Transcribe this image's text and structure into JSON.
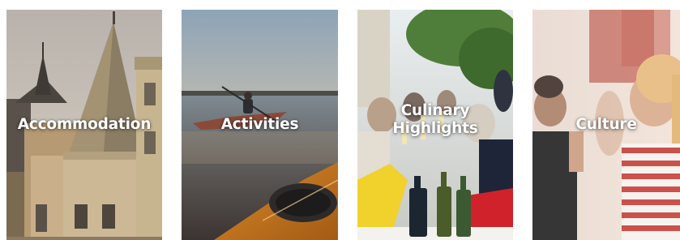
{
  "cards": [
    {
      "label": "Accommodation"
    },
    {
      "label": "Activities"
    },
    {
      "label": "Culinary Highlights"
    },
    {
      "label": "Culture"
    }
  ],
  "colors": {
    "label_text": "#ffffff",
    "page_background": "#ffffff"
  }
}
